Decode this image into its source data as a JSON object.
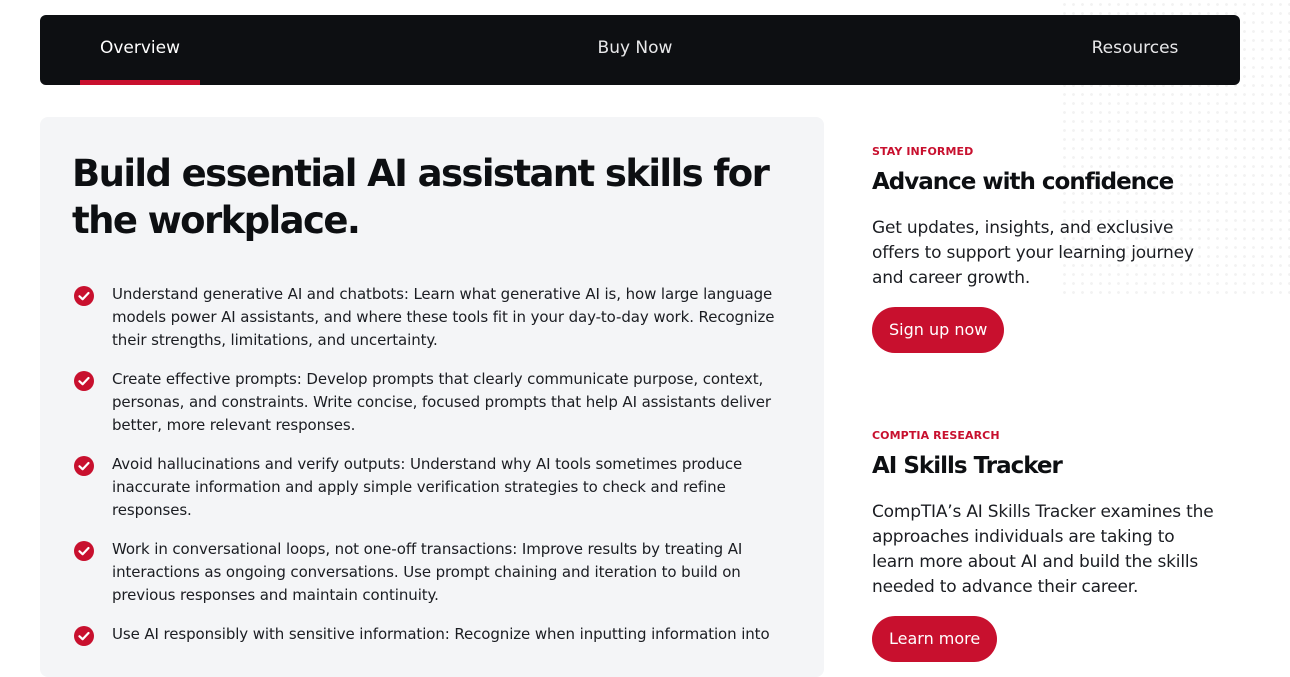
{
  "nav": {
    "tabs": [
      {
        "label": "Overview",
        "active": true
      },
      {
        "label": "Buy Now",
        "active": false
      },
      {
        "label": "Resources",
        "active": false
      }
    ]
  },
  "main": {
    "title": "Build essential AI assistant skills for the workplace.",
    "skills": [
      "Understand generative AI and chatbots: Learn what generative AI is, how large language models power AI assistants, and where these tools fit in your day-to-day work. Recognize their strengths, limitations, and uncertainty.",
      "Create effective prompts: Develop prompts that clearly communicate purpose, context, personas, and constraints. Write concise, focused prompts that help AI assistants deliver better, more relevant responses.",
      "Avoid hallucinations and verify outputs: Understand why AI tools sometimes produce inaccurate information and apply simple verification strategies to check and refine responses.",
      "Work in conversational loops, not one-off transactions: Improve results by treating AI interactions as ongoing conversations. Use prompt chaining and iteration to build on previous responses and maintain continuity.",
      "Use AI responsibly with sensitive information: Recognize when inputting information into"
    ]
  },
  "sidebar": {
    "stay_informed": {
      "eyebrow": "STAY INFORMED",
      "title": "Advance with confidence",
      "text": "Get updates, insights, and exclusive offers to support your learning journey and career growth.",
      "button": "Sign up now"
    },
    "research": {
      "eyebrow": "COMPTIA RESEARCH",
      "title": "AI Skills Tracker",
      "text": "CompTIA’s AI Skills Tracker examines the approaches individuals are taking to learn more about AI and build the skills needed to advance their career.",
      "button": "Learn more"
    }
  },
  "colors": {
    "accent": "#c8102e",
    "nav_bg": "#0d0f12",
    "card_bg": "#f4f5f7"
  },
  "icons": {
    "bullet": "check-circle-icon"
  }
}
